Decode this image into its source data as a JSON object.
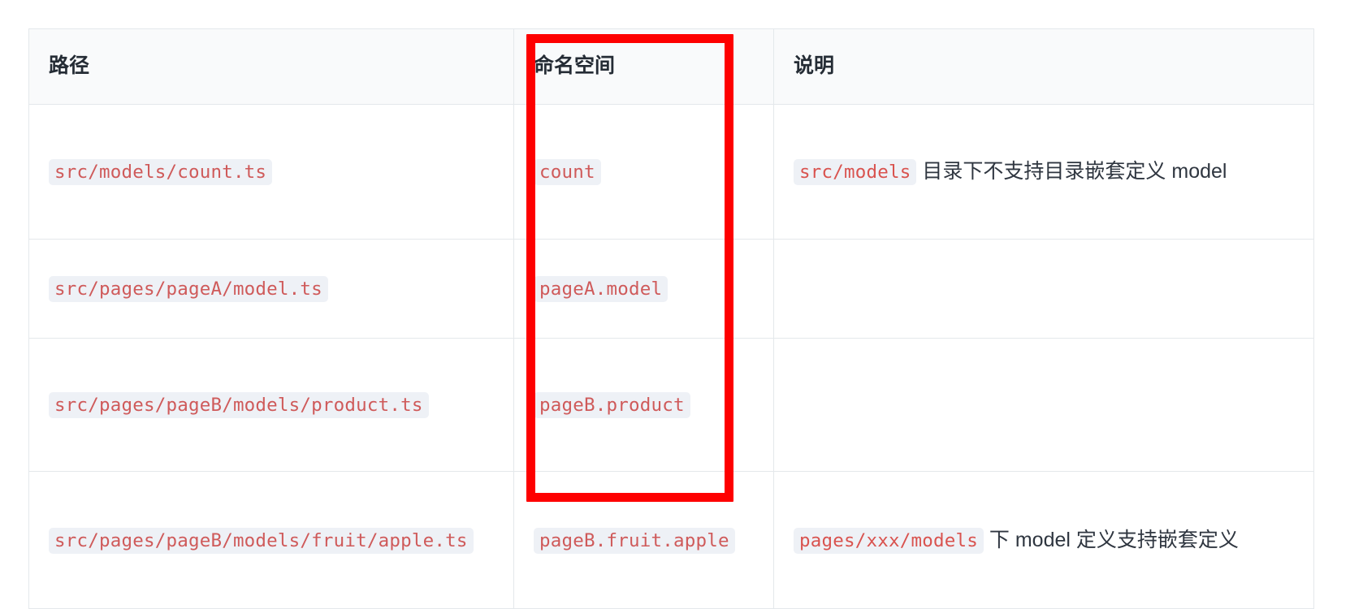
{
  "table": {
    "columns": [
      {
        "key": "path",
        "label": "路径"
      },
      {
        "key": "namespace",
        "label": "命名空间"
      },
      {
        "key": "desc",
        "label": "说明"
      }
    ],
    "rows": [
      {
        "path": "src/models/count.ts",
        "namespace": "count",
        "desc_code": "src/models",
        "desc_text": "目录下不支持目录嵌套定义 model"
      },
      {
        "path": "src/pages/pageA/model.ts",
        "namespace": "pageA.model",
        "desc_code": "",
        "desc_text": ""
      },
      {
        "path": "src/pages/pageB/models/product.ts",
        "namespace": "pageB.product",
        "desc_code": "",
        "desc_text": ""
      },
      {
        "path": "src/pages/pageB/models/fruit/apple.ts",
        "namespace": "pageB.fruit.apple",
        "desc_code": "pages/xxx/models",
        "desc_text": "下 model 定义支持嵌套定义"
      }
    ]
  },
  "annotation": {
    "shape": "rectangle",
    "color": "#fe0000",
    "target_column": "命名空间"
  },
  "colors": {
    "header_background": "#f9fafb",
    "border": "#e4e8eb",
    "code_background": "#eef1f6",
    "code_text": "#cf5a5a",
    "body_text": "#2f3640",
    "annotation": "#fe0000"
  }
}
